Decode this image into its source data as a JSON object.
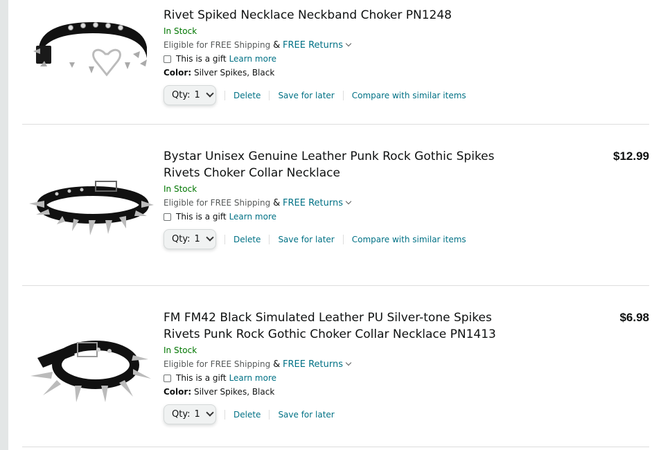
{
  "items": [
    {
      "title_line2": "Rivet Spiked Necklace Neckband Choker PN1248",
      "price": "",
      "stock": "In Stock",
      "shipping_prefix": "Eligible for FREE Shipping",
      "shipping_amp": "&",
      "free_returns": "FREE Returns",
      "gift_label": "This is a gift",
      "learn_more": "Learn more",
      "color_label": "Color:",
      "color_value": "Silver Spikes, Black",
      "qty_label": "Qty:",
      "qty_value": "1",
      "delete": "Delete",
      "save_for_later": "Save for later",
      "compare": "Compare with similar items"
    },
    {
      "title": "Bystar Unisex Genuine Leather Punk Rock Gothic Spikes Rivets Choker Collar Necklace",
      "price": "$12.99",
      "stock": "In Stock",
      "shipping_prefix": "Eligible for FREE Shipping",
      "shipping_amp": "&",
      "free_returns": "FREE Returns",
      "gift_label": "This is a gift",
      "learn_more": "Learn more",
      "qty_label": "Qty:",
      "qty_value": "1",
      "delete": "Delete",
      "save_for_later": "Save for later",
      "compare": "Compare with similar items"
    },
    {
      "title": "FM FM42 Black Simulated Leather PU Silver-tone Spikes Rivets Punk Rock Gothic Choker Collar Necklace PN1413",
      "price": "$6.98",
      "stock": "In Stock",
      "shipping_prefix": "Eligible for FREE Shipping",
      "shipping_amp": "&",
      "free_returns": "FREE Returns",
      "gift_label": "This is a gift",
      "learn_more": "Learn more",
      "color_label": "Color:",
      "color_value": "Silver Spikes, Black",
      "qty_label": "Qty:",
      "qty_value": "1",
      "delete": "Delete",
      "save_for_later": "Save for later"
    }
  ],
  "icons": [
    "heart-choker-image",
    "spiked-collar-image",
    "buckle-choker-image",
    "chevron-down-icon",
    "checkbox"
  ],
  "colors": {
    "link": "#007185",
    "in_stock": "#007600",
    "text": "#0F1111",
    "muted": "#565959"
  }
}
